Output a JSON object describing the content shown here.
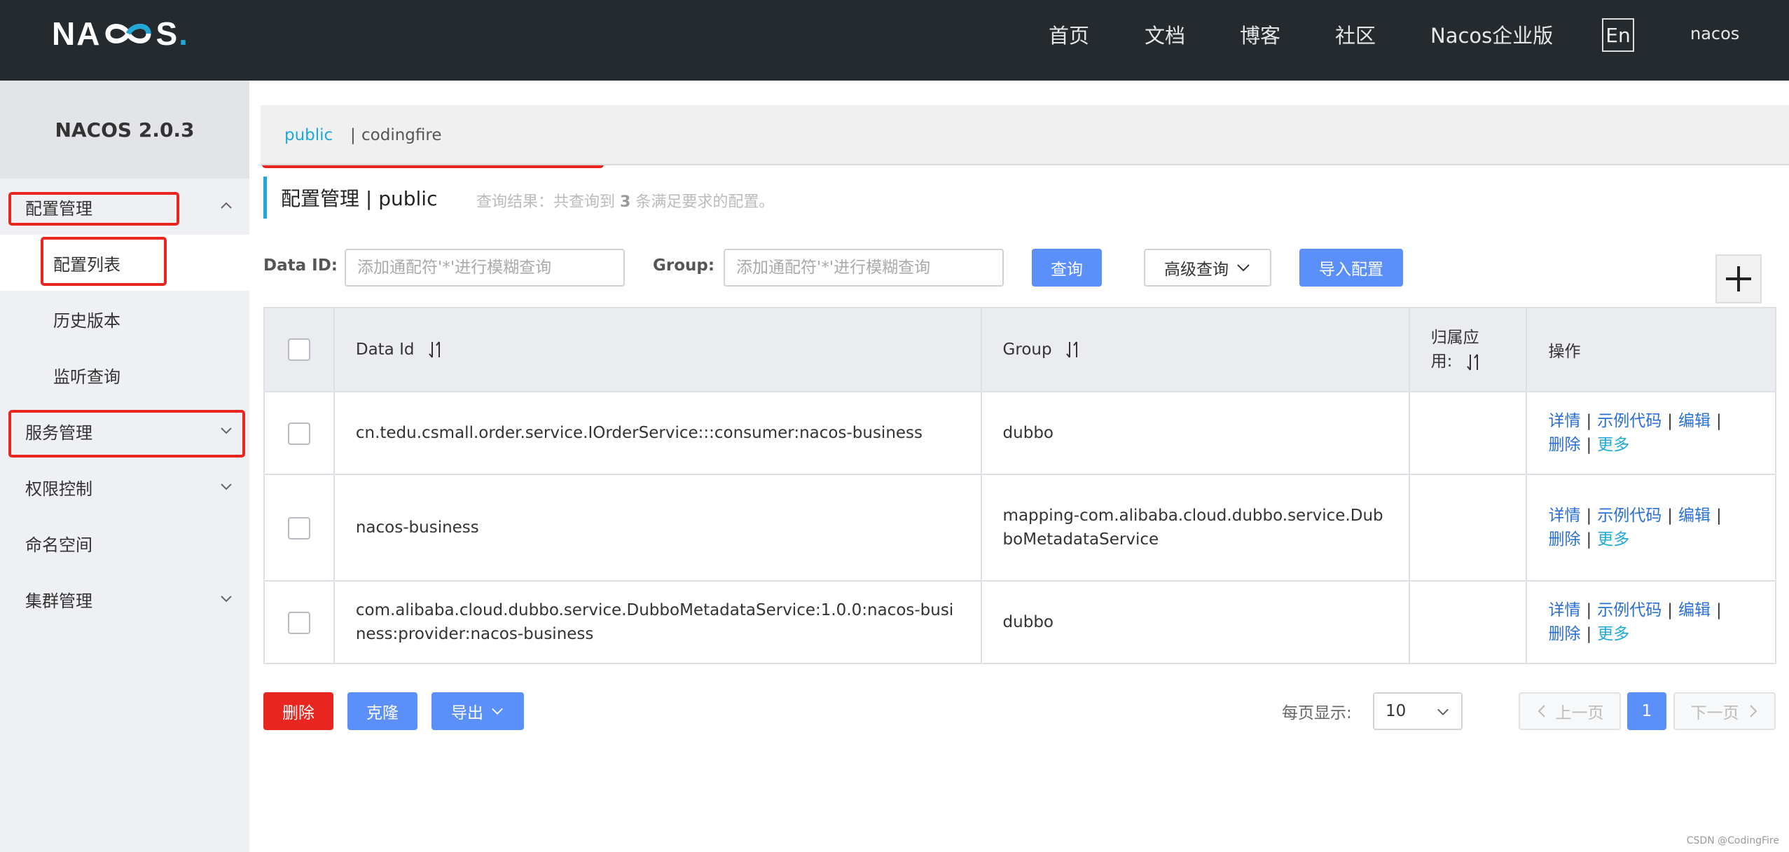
{
  "header": {
    "logo_left": "NA",
    "logo_right": "S",
    "logo_dot": ".",
    "nav": [
      {
        "label": "首页"
      },
      {
        "label": "文档"
      },
      {
        "label": "博客"
      },
      {
        "label": "社区"
      },
      {
        "label": "Nacos企业版"
      }
    ],
    "lang": "En",
    "user": "nacos"
  },
  "sidebar": {
    "title": "NACOS 2.0.3",
    "items": [
      {
        "label": "配置管理"
      },
      {
        "label": "配置列表"
      },
      {
        "label": "历史版本"
      },
      {
        "label": "监听查询"
      },
      {
        "label": "服务管理"
      },
      {
        "label": "权限控制"
      },
      {
        "label": "命名空间"
      },
      {
        "label": "集群管理"
      }
    ]
  },
  "namespace": {
    "active": "public",
    "separator": "|",
    "other": "codingfire"
  },
  "page": {
    "title": "配置管理 | public",
    "hint_prefix": "查询结果：共查询到",
    "hint_count": "3",
    "hint_suffix": "条满足要求的配置。"
  },
  "filters": {
    "data_id_label": "Data ID:",
    "data_id_placeholder": "添加通配符'*'进行模糊查询",
    "group_label": "Group:",
    "group_placeholder": "添加通配符'*'进行模糊查询",
    "search_btn": "查询",
    "advanced_btn": "高级查询",
    "import_btn": "导入配置"
  },
  "table": {
    "headers": {
      "data_id": "Data Id",
      "group": "Group",
      "app_line1": "归属应",
      "app_line2": "用:",
      "ops": "操作"
    },
    "ops": {
      "detail": "详情",
      "sample": "示例代码",
      "edit": "编辑",
      "delete": "删除",
      "more": "更多",
      "sep": "|"
    },
    "rows": [
      {
        "data_id": "cn.tedu.csmall.order.service.IOrderService:::consumer:nacos-business",
        "group": "dubbo",
        "app": ""
      },
      {
        "data_id": "nacos-business",
        "group": "mapping-com.alibaba.cloud.dubbo.service.DubboMetadataService",
        "app": ""
      },
      {
        "data_id": "com.alibaba.cloud.dubbo.service.DubboMetadataService:1.0.0:nacos-business:provider:nacos-business",
        "group": "dubbo",
        "app": ""
      }
    ]
  },
  "footer": {
    "delete_btn": "删除",
    "clone_btn": "克隆",
    "export_btn": "导出",
    "page_size_label": "每页显示:",
    "page_size": "10",
    "prev": "上一页",
    "next": "下一页",
    "current_page": "1"
  },
  "watermark": "CSDN @CodingFire",
  "colors": {
    "header_bg": "#252a2f",
    "accent": "#20a8d8",
    "primary": "#5b8ff9",
    "danger": "#e8261f",
    "highlight_box": "#e8261f"
  }
}
